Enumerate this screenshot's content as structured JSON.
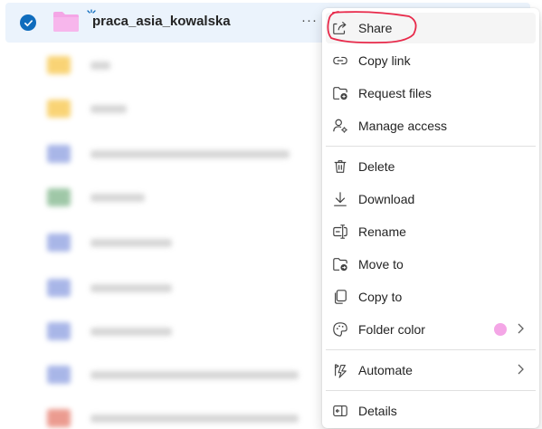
{
  "selected_item": {
    "name": "praca_asia_kowalska",
    "more_label": "···"
  },
  "menu": {
    "items": [
      {
        "label": "Share",
        "icon": "share-icon"
      },
      {
        "label": "Copy link",
        "icon": "link-icon"
      },
      {
        "label": "Request files",
        "icon": "request-files-icon"
      },
      {
        "label": "Manage access",
        "icon": "manage-access-icon"
      },
      {
        "label": "Delete",
        "icon": "trash-icon"
      },
      {
        "label": "Download",
        "icon": "download-icon"
      },
      {
        "label": "Rename",
        "icon": "rename-icon"
      },
      {
        "label": "Move to",
        "icon": "move-to-icon"
      },
      {
        "label": "Copy to",
        "icon": "copy-to-icon"
      },
      {
        "label": "Folder color",
        "icon": "palette-icon",
        "swatch": "#f4a6e6"
      },
      {
        "label": "Automate",
        "icon": "automate-icon"
      },
      {
        "label": "Details",
        "icon": "details-icon"
      }
    ]
  },
  "colors": {
    "accent": "#0f6cbd",
    "selected_row": "#ebf3fc",
    "folder_pink": "#f4a6e6",
    "annotation": "#e8294a"
  }
}
